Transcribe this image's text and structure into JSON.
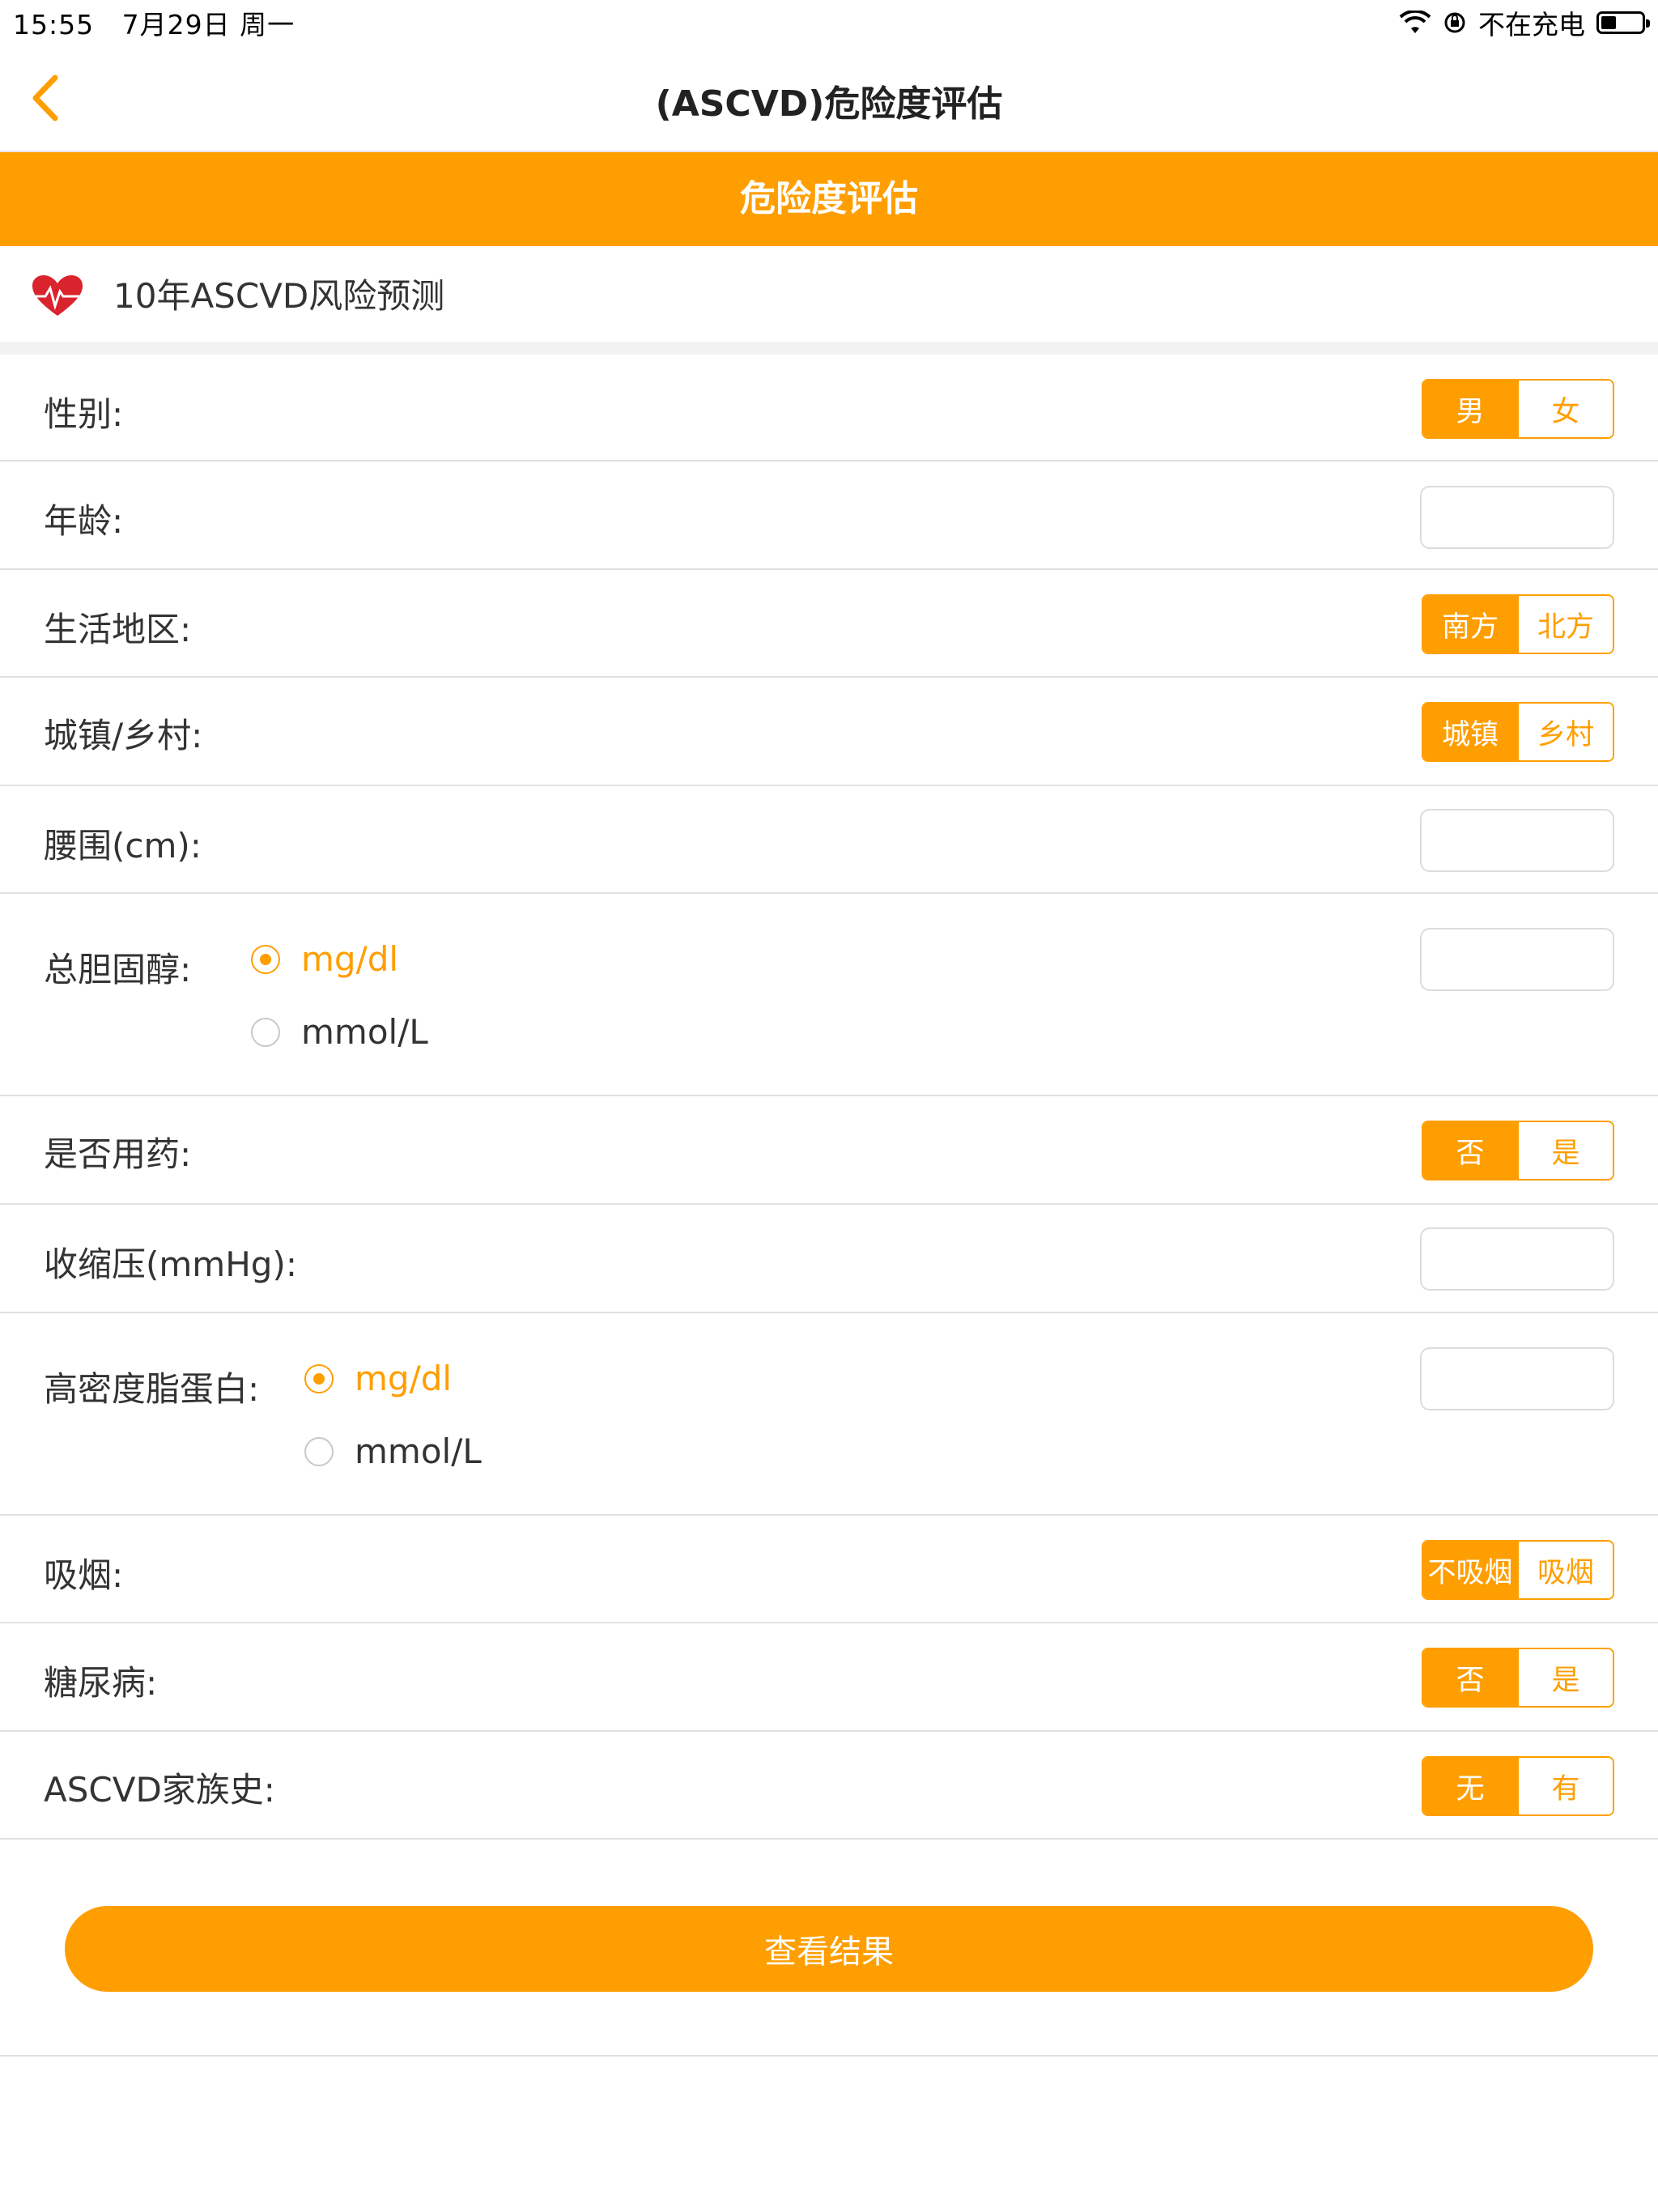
{
  "status_bar": {
    "time": "15:55",
    "date": "7月29日 周一",
    "charging": "不在充电"
  },
  "nav": {
    "title": "(ASCVD)危险度评估"
  },
  "banner": {
    "title": "危险度评估"
  },
  "section": {
    "title": "10年ASCVD风险预测"
  },
  "form": {
    "gender": {
      "label": "性别:",
      "options": [
        "男",
        "女"
      ],
      "selected": "男"
    },
    "age": {
      "label": "年龄:",
      "value": ""
    },
    "region": {
      "label": "生活地区:",
      "options": [
        "南方",
        "北方"
      ],
      "selected": "南方"
    },
    "urban": {
      "label": "城镇/乡村:",
      "options": [
        "城镇",
        "乡村"
      ],
      "selected": "城镇"
    },
    "waist": {
      "label": "腰围(cm):",
      "value": ""
    },
    "cholesterol": {
      "label": "总胆固醇:",
      "units": [
        "mg/dl",
        "mmol/L"
      ],
      "selected_unit": "mg/dl",
      "value": ""
    },
    "medication": {
      "label": "是否用药:",
      "options": [
        "否",
        "是"
      ],
      "selected": "否"
    },
    "systolic": {
      "label": "收缩压(mmHg):",
      "value": ""
    },
    "hdl": {
      "label": "高密度脂蛋白:",
      "units": [
        "mg/dl",
        "mmol/L"
      ],
      "selected_unit": "mg/dl",
      "value": ""
    },
    "smoking": {
      "label": "吸烟:",
      "options": [
        "不吸烟",
        "吸烟"
      ],
      "selected": "不吸烟"
    },
    "diabetes": {
      "label": "糖尿病:",
      "options": [
        "否",
        "是"
      ],
      "selected": "否"
    },
    "family_history": {
      "label": "ASCVD家族史:",
      "options": [
        "无",
        "有"
      ],
      "selected": "无"
    }
  },
  "submit": {
    "label": "查看结果"
  },
  "colors": {
    "accent": "#ff9e00",
    "divider": "#e0e0e0",
    "text": "#333333"
  }
}
